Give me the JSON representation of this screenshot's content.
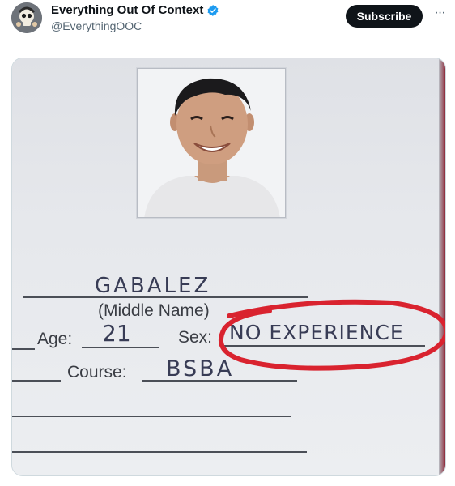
{
  "header": {
    "account_name": "Everything Out Of Context",
    "handle": "@EverythingOOC",
    "subscribe_label": "Subscribe",
    "more_icon": "more-horizontal-icon",
    "verified_icon": "verified-badge-icon",
    "accent_color": "#1d9bf0"
  },
  "media": {
    "form": {
      "surname_value": "GABALEZ",
      "middle_name_label": "(Middle Name)",
      "age_label": "Age:",
      "age_value": "21",
      "sex_label": "Sex:",
      "sex_value": "NO EXPERIENCE",
      "course_label": "Course:",
      "course_value": "BSBA"
    },
    "annotation_color": "#d9232f"
  }
}
